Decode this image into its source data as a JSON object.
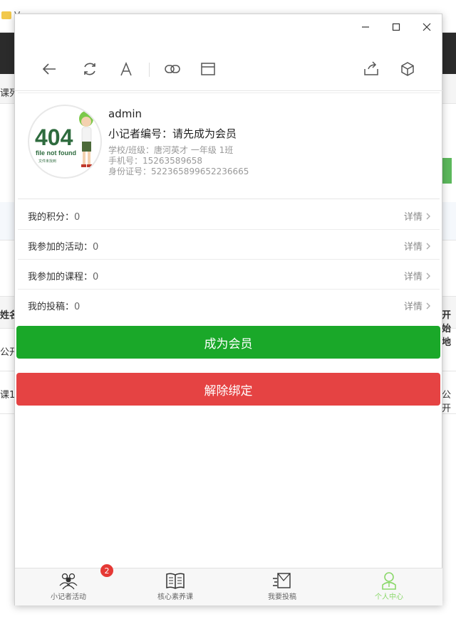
{
  "background": {
    "tabs": [
      "V",
      "",
      "",
      ""
    ],
    "left_cut_labels": [
      "课列",
      "姓名",
      "公开",
      "课1"
    ],
    "right_cut_labels": [
      "开始地",
      "公开"
    ]
  },
  "profile": {
    "username": "admin",
    "reporter_no": "小记者编号：请先成为会员",
    "school_class": "学校/班级：唐河英才 一年级 1班",
    "phone": "手机号：15263589658",
    "id_card": "身份证号：522365899652236665",
    "avatar_text_big": "404",
    "avatar_text_sub": "file not found",
    "avatar_text_cn": "文件未找到"
  },
  "list": [
    {
      "label": "我的积分：",
      "value": "0",
      "detail": "详情"
    },
    {
      "label": "我参加的活动：",
      "value": "0",
      "detail": "详情"
    },
    {
      "label": "我参加的课程：",
      "value": "0",
      "detail": "详情"
    },
    {
      "label": "我的投稿：",
      "value": "0",
      "detail": "详情"
    }
  ],
  "buttons": {
    "become_member": "成为会员",
    "unbind": "解除绑定"
  },
  "tabbar": [
    {
      "label": "小记者活动",
      "icon": "people-icon",
      "badge": "2"
    },
    {
      "label": "核心素养课",
      "icon": "book-icon"
    },
    {
      "label": "我要投稿",
      "icon": "submit-icon"
    },
    {
      "label": "个人中心",
      "icon": "person-icon",
      "active": true
    }
  ],
  "colors": {
    "green": "#1aa829",
    "red": "#e54343",
    "active_tab": "#8bd86b"
  }
}
